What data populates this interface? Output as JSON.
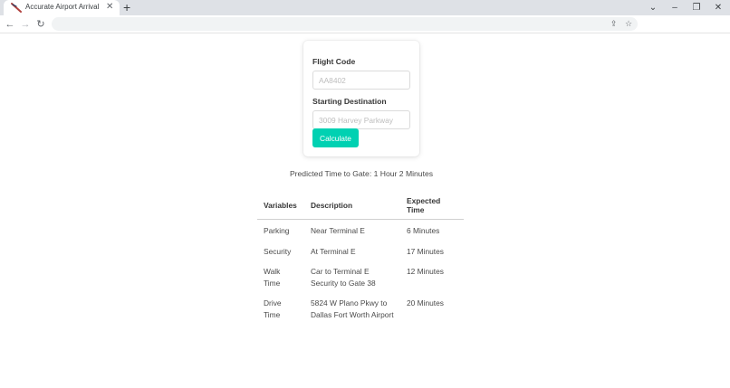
{
  "browser": {
    "tab_title": "Accurate Airport Arrival",
    "close_glyph": "✕",
    "new_tab_glyph": "+",
    "win_minimize": "⌄",
    "win_min": "–",
    "win_restore": "❐",
    "win_close": "✕",
    "back_glyph": "←",
    "forward_glyph": "→",
    "reload_glyph": "↻",
    "share_glyph": "⇪",
    "star_glyph": "☆"
  },
  "form": {
    "flight_code_label": "Flight Code",
    "flight_code_placeholder": "AA8402",
    "flight_code_value": "",
    "starting_destination_label": "Starting Destination",
    "starting_destination_placeholder": "3009 Harvey Parkway",
    "starting_destination_value": "",
    "calculate_label": "Calculate"
  },
  "prediction_text": "Predicted Time to Gate: 1 Hour 2 Minutes",
  "table": {
    "headers": [
      "Variables",
      "Description",
      "Expected Time"
    ],
    "rows": [
      {
        "variable": "Parking",
        "description": [
          "Near Terminal E"
        ],
        "time": "6 Minutes"
      },
      {
        "variable": "Security",
        "description": [
          "At Terminal E"
        ],
        "time": "17 Minutes"
      },
      {
        "variable": "Walk Time",
        "description": [
          "Car to Terminal E",
          "Security to Gate 38"
        ],
        "time": "12 Minutes"
      },
      {
        "variable": "Drive Time",
        "description": [
          "5824 W Plano Pkwy to",
          "Dallas Fort Worth Airport"
        ],
        "time": "20 Minutes"
      }
    ]
  },
  "colors": {
    "accent": "#00d1b2",
    "chrome_bg": "#dee1e6",
    "omnibox_bg": "#f1f3f4"
  }
}
